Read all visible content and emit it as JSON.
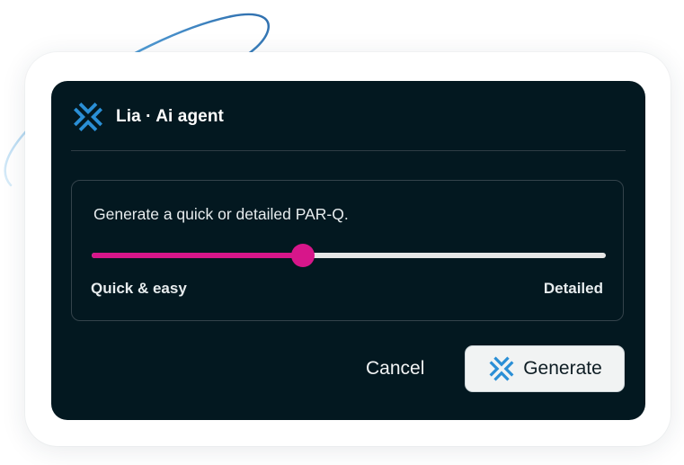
{
  "agent": {
    "title": "Lia · Ai agent",
    "logo_icon": "lia-cross-arrows-icon"
  },
  "parq": {
    "prompt": "Generate a quick or detailed PAR-Q.",
    "slider": {
      "value_fraction": 0.41,
      "min_label": "Quick & easy",
      "max_label": "Detailed"
    }
  },
  "actions": {
    "cancel_label": "Cancel",
    "generate_label": "Generate",
    "generate_icon": "lia-cross-arrows-icon"
  },
  "colors": {
    "panel_bg": "#031820",
    "accent_blue": "#2a8fd6",
    "slider_fill": "#d7168a",
    "slider_track": "#e6e6e6"
  }
}
